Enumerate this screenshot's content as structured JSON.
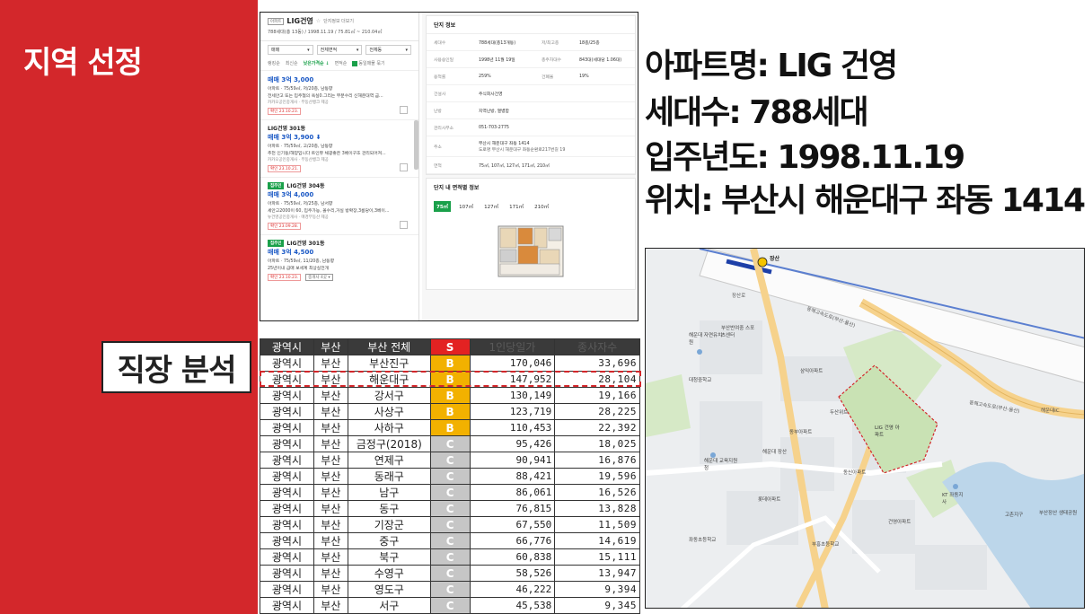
{
  "slide": {
    "title": "지역 선정",
    "workplace_label": "직장 분석"
  },
  "listing": {
    "complex_tag": "아파트",
    "complex_name": "LIG건영",
    "complex_star": "☆",
    "complex_link": "단지정보 더보기",
    "complex_meta": "788세대(총 13동) / 1998.11.19 / 75.81㎡ ~ 210.04㎡",
    "filters": [
      "매매",
      "전체면적",
      "전체동"
    ],
    "sorts": [
      "랭킹순",
      "최신순",
      "낮은가격순 ↓",
      "면적순"
    ],
    "same_listing": "동일매물 묶기",
    "items": [
      {
        "name": "",
        "price": "매매 3억 3,000",
        "desc": "아파트 · 75/59㎡, 저/20층, 남동향",
        "desc2": "전세안고 또는 입주협의 욕실0.그리는 부분수리 신해운대역 금...",
        "agent": "카카오공인중개사 · 부동산뱅크 제공",
        "date": "확인 23.10.23."
      },
      {
        "name": "LIG건영 301동",
        "price": "매매 3억 3,900",
        "desc": "아파트 · 75/59㎡, 고/20층, 남동향",
        "desc2": "추천 인기동/해양입니다 트인뷰 채광좋은 3베이구조 관리되어져...",
        "agent": "카카오공인중개사 · 부동산뱅크 제공",
        "date": "확인 23.10.21."
      },
      {
        "name": "LIG건영 304동",
        "price": "매매 3억 4,000",
        "desc": "아파트 · 75/59㎡, 저/25층, 남서향",
        "desc2": "세안고2000이 60, 입주가능, 올수리,거실 방확장,3룸당이,3베이...",
        "agent": "뉴건영공인중개사 · 매경부동산 제공",
        "date": "확인 23.09.28."
      },
      {
        "name": "LIG건영 301동",
        "price": "매매 3억 4,500",
        "desc": "아파트 · 75/59㎡, 11/20층, 남동향",
        "desc2": "25년이내  급매  보세계  최상실전개",
        "agent": "",
        "date": "확인 23.10.23."
      }
    ],
    "tag_confirm": "집주인",
    "agent_more": "중개사 4곳",
    "detail": {
      "title": "단지 정보",
      "rows": [
        {
          "k1": "세대수",
          "v1": "788세대(총13개동)",
          "k2": "저/최고층",
          "v2": "18층/25층"
        },
        {
          "k1": "사용승인일",
          "v1": "1998년 11월 19일",
          "k2": "총주차대수",
          "v2": "843대(세대당 1.06대)"
        },
        {
          "k1": "용적률",
          "v1": "259%",
          "k2": "건폐율",
          "v2": "19%"
        },
        {
          "k1": "건설사",
          "v1": "주식회사건영"
        },
        {
          "k1": "난방",
          "v1": "지역난방, 열병합"
        },
        {
          "k1": "관리사무소",
          "v1": "051-703-2775"
        },
        {
          "k1": "주소",
          "v1": "부산시 해운대구 좌동 1414",
          "v1b": "도로명 부산시 해운대구 좌동순환로217번길 19"
        },
        {
          "k1": "면적",
          "v1": "75㎡, 107㎡, 127㎡, 171㎡, 210㎡"
        }
      ],
      "area_title": "단지 내 면적별 정보",
      "area_tabs": [
        "75㎡",
        "107㎡",
        "127㎡",
        "171㎡",
        "210㎡"
      ]
    }
  },
  "info_lines": [
    "아파트명: LIG 건영",
    "세대수: 788세대",
    "입주년도: 1998.11.19",
    "위치: 부산시 해운대구 좌동 1414"
  ],
  "table": {
    "headers": [
      "광역시",
      "부산",
      "부산 전체",
      "S",
      "1인당일가",
      "종사자수"
    ],
    "rows": [
      {
        "a": "광역시",
        "b": "부산",
        "c": "부산진구",
        "g": "B",
        "v1": "170,046",
        "v2": "33,696"
      },
      {
        "a": "광역시",
        "b": "부산",
        "c": "해운대구",
        "g": "B",
        "v1": "147,952",
        "v2": "28,104"
      },
      {
        "a": "광역시",
        "b": "부산",
        "c": "강서구",
        "g": "B",
        "v1": "130,149",
        "v2": "19,166"
      },
      {
        "a": "광역시",
        "b": "부산",
        "c": "사상구",
        "g": "B",
        "v1": "123,719",
        "v2": "28,225"
      },
      {
        "a": "광역시",
        "b": "부산",
        "c": "사하구",
        "g": "B",
        "v1": "110,453",
        "v2": "22,392"
      },
      {
        "a": "광역시",
        "b": "부산",
        "c": "금정구(2018)",
        "g": "C",
        "v1": "95,426",
        "v2": "18,025"
      },
      {
        "a": "광역시",
        "b": "부산",
        "c": "연제구",
        "g": "C",
        "v1": "90,941",
        "v2": "16,876"
      },
      {
        "a": "광역시",
        "b": "부산",
        "c": "동래구",
        "g": "C",
        "v1": "88,421",
        "v2": "19,596"
      },
      {
        "a": "광역시",
        "b": "부산",
        "c": "남구",
        "g": "C",
        "v1": "86,061",
        "v2": "16,526"
      },
      {
        "a": "광역시",
        "b": "부산",
        "c": "동구",
        "g": "C",
        "v1": "76,815",
        "v2": "13,828"
      },
      {
        "a": "광역시",
        "b": "부산",
        "c": "기장군",
        "g": "C",
        "v1": "67,550",
        "v2": "11,509"
      },
      {
        "a": "광역시",
        "b": "부산",
        "c": "중구",
        "g": "C",
        "v1": "66,776",
        "v2": "14,619"
      },
      {
        "a": "광역시",
        "b": "부산",
        "c": "북구",
        "g": "C",
        "v1": "60,838",
        "v2": "15,111"
      },
      {
        "a": "광역시",
        "b": "부산",
        "c": "수영구",
        "g": "C",
        "v1": "58,526",
        "v2": "13,947"
      },
      {
        "a": "광역시",
        "b": "부산",
        "c": "영도구",
        "g": "C",
        "v1": "46,222",
        "v2": "9,394"
      },
      {
        "a": "광역시",
        "b": "부산",
        "c": "서구",
        "g": "C",
        "v1": "45,538",
        "v2": "9,345"
      }
    ]
  },
  "map": {
    "labels": {
      "center": "부산반여중 스포츠센터",
      "road1": "동해고속도로(부산-울산)",
      "road2": "동해고속도로(부산-울산)",
      "complex": "LIG 건영 아파트",
      "school1": "해운대 자연유치원",
      "school2": "좌동초등학교",
      "school3": "부흥초등학교",
      "school4": "대청중학교",
      "school5": "해운대 교육지원청",
      "apt1": "삼익아파트",
      "apt2": "동부아파트",
      "apt3": "두산위브",
      "apt4": "롯데아파트",
      "apt5": "동신아파트",
      "apt6": "건영아파트",
      "center2": "해운대 장산",
      "kt": "KT 좌동지사",
      "park": "부산장산 생태공원",
      "gate": "고촌지구",
      "station": "장산",
      "ic": "해운대IC",
      "tower": "장산로"
    },
    "colors": {
      "highlight": "#d3272b",
      "green": "#c9e2b4",
      "road": "#f6d28c",
      "water": "#bcd6ea"
    }
  },
  "colors": {
    "accent": "#d3272b",
    "grade_b": "#f2b100",
    "grade_c": "#c6c6c6",
    "price_blue": "#1a58c5",
    "naver_green": "#1aa04a"
  }
}
